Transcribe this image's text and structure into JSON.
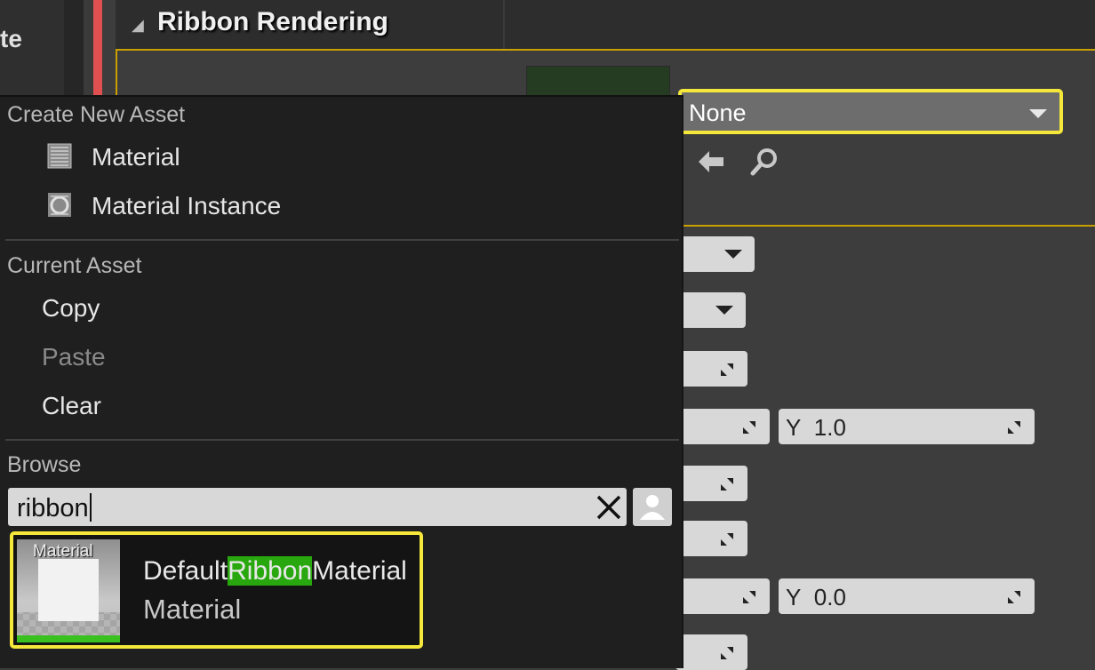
{
  "background": {
    "left_panel_partial_text": "te",
    "section_title": "Ribbon Rendering",
    "material_combo_value": "None",
    "fields": [
      {
        "label_axis": "Y",
        "value": "1.0"
      },
      {
        "label_axis": "Y",
        "value": "0.0"
      }
    ],
    "icons": [
      "back-arrow-icon",
      "search-icon"
    ]
  },
  "menu": {
    "create_heading": "Create New Asset",
    "create_items": [
      {
        "label": "Material",
        "icon": "material-icon"
      },
      {
        "label": "Material Instance",
        "icon": "material-instance-icon"
      }
    ],
    "current_heading": "Current Asset",
    "current_items": [
      {
        "label": "Copy",
        "enabled": true
      },
      {
        "label": "Paste",
        "enabled": false
      },
      {
        "label": "Clear",
        "enabled": true
      }
    ],
    "browse_heading": "Browse",
    "search_value": "ribbon",
    "result": {
      "thumb_label": "Material",
      "name_prefix": "Default",
      "name_match": "Ribbon",
      "name_suffix": "Material",
      "type": "Material"
    }
  },
  "colors": {
    "highlight_border": "#f5e83a",
    "match_highlight": "#28a80e",
    "section_border": "#c9a000"
  }
}
